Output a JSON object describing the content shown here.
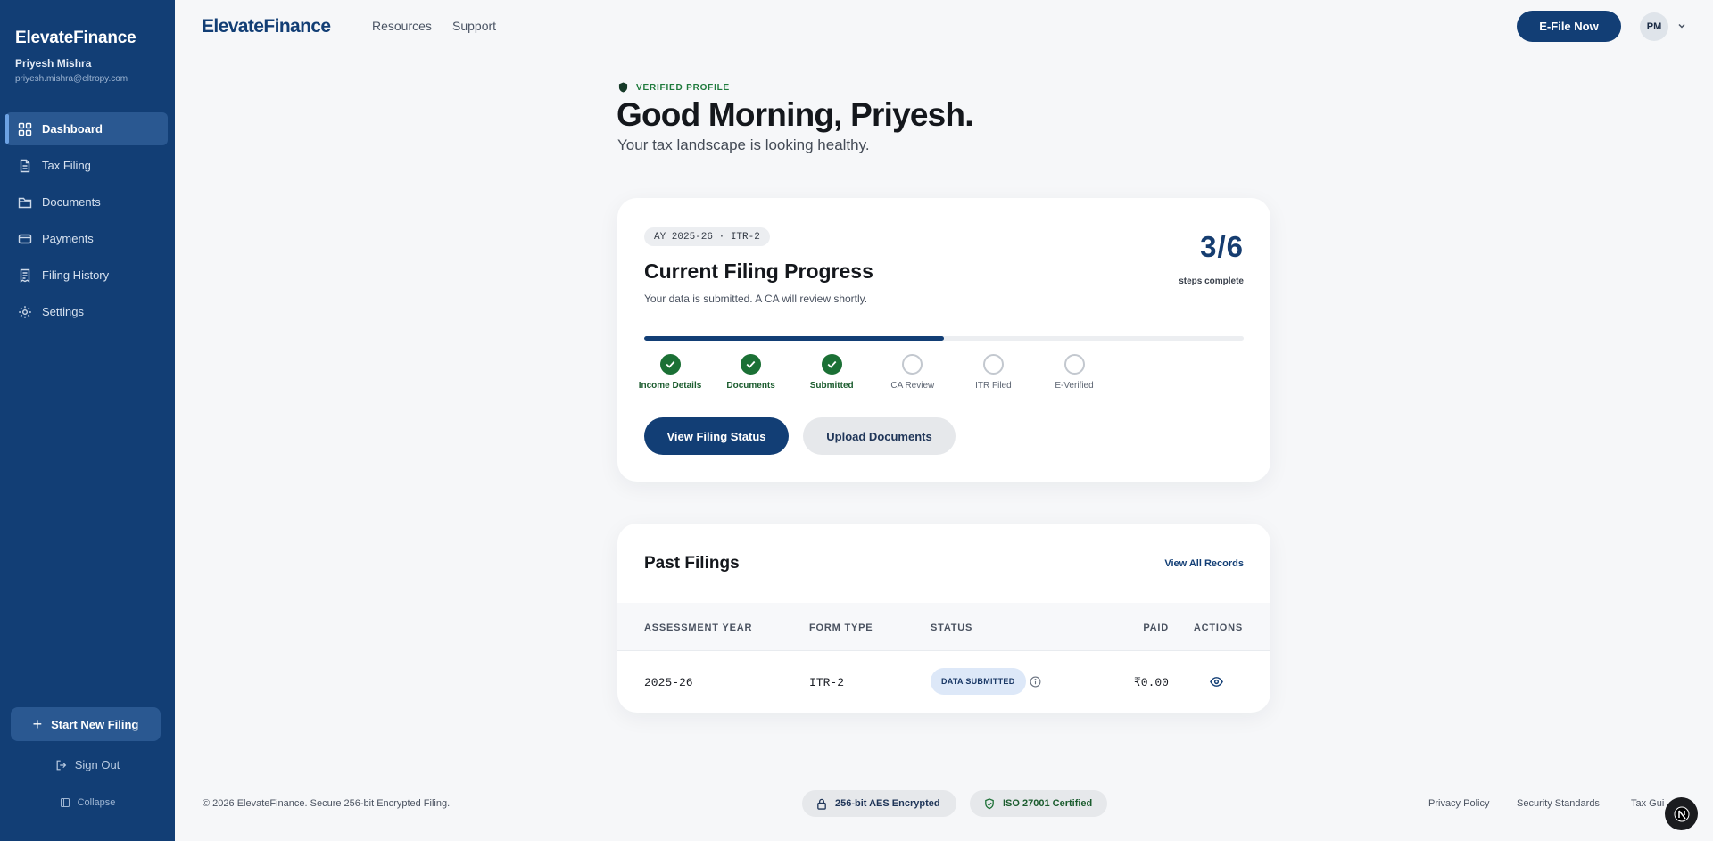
{
  "sidebar": {
    "brand": "ElevateFinance",
    "user_name": "Priyesh Mishra",
    "user_email": "priyesh.mishra@eltropy.com",
    "items": [
      {
        "label": "Dashboard",
        "icon": "dashboard-grid-icon",
        "active": true
      },
      {
        "label": "Tax Filing",
        "icon": "document-icon",
        "active": false
      },
      {
        "label": "Documents",
        "icon": "folder-icon",
        "active": false
      },
      {
        "label": "Payments",
        "icon": "credit-card-icon",
        "active": false
      },
      {
        "label": "Filing History",
        "icon": "receipt-icon",
        "active": false
      },
      {
        "label": "Settings",
        "icon": "gear-icon",
        "active": false
      }
    ],
    "start_label": "Start New Filing",
    "signout_label": "Sign Out",
    "collapse_label": "Collapse"
  },
  "topbar": {
    "logo": "ElevateFinance",
    "links": [
      "Resources",
      "Support"
    ],
    "efile_label": "E-File Now",
    "avatar_initials": "PM"
  },
  "greeting": {
    "verified_label": "VERIFIED PROFILE",
    "title": "Good Morning, Priyesh.",
    "subtitle": "Your tax landscape is looking healthy."
  },
  "progress": {
    "ay_label": "AY 2025-26 · ITR-2",
    "title": "Current Filing Progress",
    "description": "Your data is submitted. A CA will review shortly.",
    "steps_count": "3/6",
    "steps_label": "steps complete",
    "completed_fraction": 0.5,
    "steps": [
      {
        "label": "Income Details",
        "done": true
      },
      {
        "label": "Documents",
        "done": true
      },
      {
        "label": "Submitted",
        "done": true
      },
      {
        "label": "CA Review",
        "done": false
      },
      {
        "label": "ITR Filed",
        "done": false
      },
      {
        "label": "E-Verified",
        "done": false
      }
    ],
    "primary_button": "View Filing Status",
    "secondary_button": "Upload Documents"
  },
  "past_filings": {
    "title": "Past Filings",
    "view_all": "View All Records",
    "columns": [
      "ASSESSMENT YEAR",
      "FORM TYPE",
      "STATUS",
      "PAID",
      "ACTIONS"
    ],
    "rows": [
      {
        "year": "2025-26",
        "form": "ITR-2",
        "status": "DATA SUBMITTED",
        "paid": "₹0.00"
      }
    ]
  },
  "footer": {
    "copyright": "© 2026 ElevateFinance. Secure 256-bit Encrypted Filing.",
    "chip_aes": "256-bit AES Encrypted",
    "chip_iso": "ISO 27001 Certified",
    "links": [
      "Privacy Policy",
      "Security Standards",
      "Tax Gui"
    ]
  },
  "colors": {
    "sidebar_bg": "#123e75",
    "primary": "#123e75",
    "success": "#1b7035",
    "page_bg": "#f6f7f9"
  }
}
